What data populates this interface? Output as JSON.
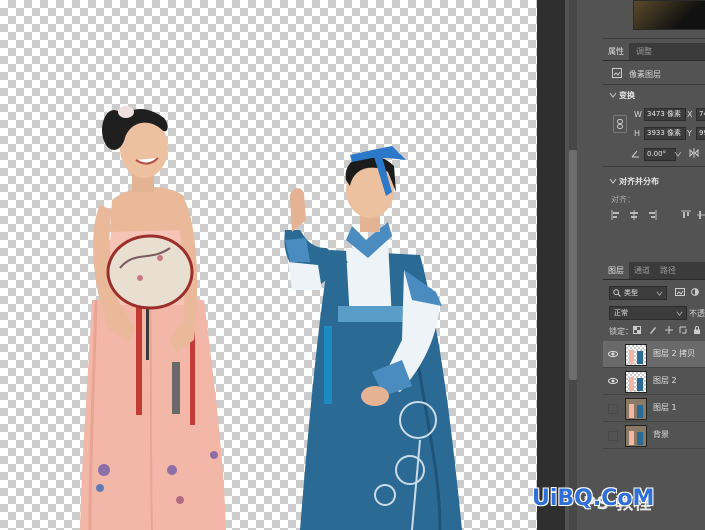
{
  "properties_panel": {
    "tabs": [
      "属性",
      "调整"
    ],
    "layer_kind": "像素图层",
    "transform_title": "变换",
    "w_label": "W",
    "w_value": "3473 像素",
    "h_label": "H",
    "h_value": "3933 像素",
    "x_label": "X",
    "x_value": "74",
    "y_label": "Y",
    "y_value": "99",
    "angle_value": "0.00°",
    "align_title": "对齐并分布",
    "align_label": "对齐："
  },
  "layers_panel": {
    "tabs": [
      "图层",
      "通道",
      "路径"
    ],
    "filter_value": "类型",
    "blend_mode": "正常",
    "opacity_label": "不透",
    "lock_label": "锁定：",
    "layers": [
      {
        "name": "图层 2 拷贝",
        "visible": true,
        "selected": true,
        "thumb": "cutout"
      },
      {
        "name": "图层 2",
        "visible": true,
        "selected": false,
        "thumb": "cutout"
      },
      {
        "name": "图层 1",
        "visible": false,
        "selected": false,
        "thumb": "photo"
      },
      {
        "name": "背景",
        "visible": false,
        "selected": false,
        "thumb": "photo"
      }
    ]
  },
  "watermark": {
    "brand": "UiBQ.CoM",
    "ghost_text": "PS 教程"
  },
  "colors": {
    "app_bg": "#535353",
    "canvas_check": "#cccccc",
    "accent_blue": "#2f6fd6"
  }
}
